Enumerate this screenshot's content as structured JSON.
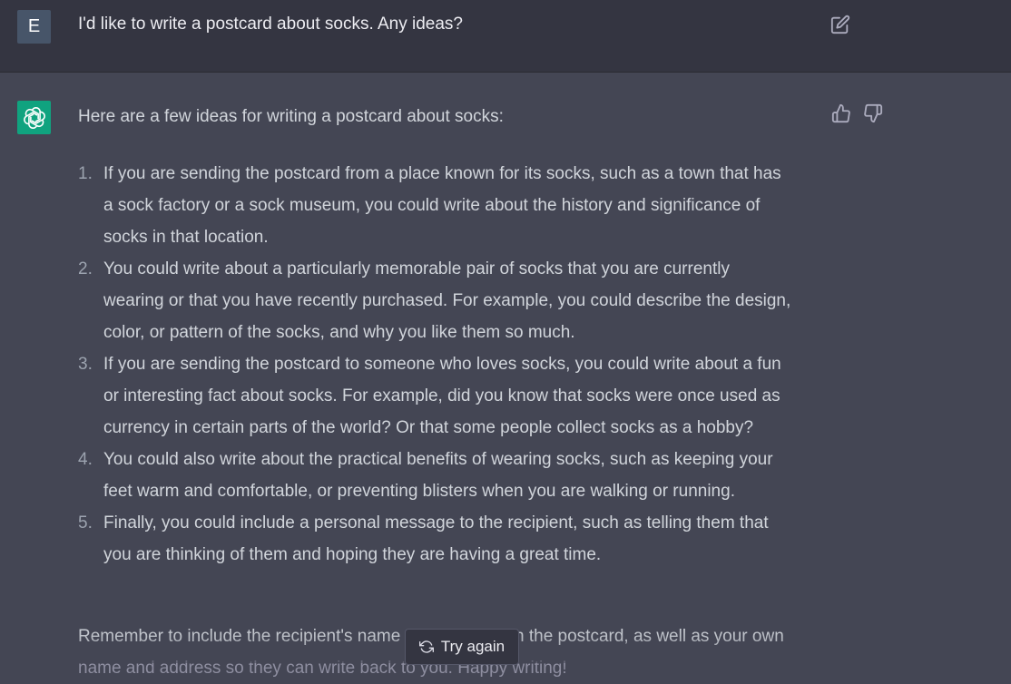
{
  "user_message": {
    "avatar_letter": "E",
    "text": "I'd like to write a postcard about socks. Any ideas?",
    "edit_icon": "edit-icon"
  },
  "assistant_message": {
    "avatar_icon": "openai-logo-icon",
    "intro": "Here are a few ideas for writing a postcard about socks:",
    "ideas": [
      {
        "number": "1.",
        "lines": [
          "If you are sending the postcard from a place known for its socks, such as a town that has",
          "a sock factory or a sock museum, you could write about the history and significance of",
          "socks in that location."
        ]
      },
      {
        "number": "2.",
        "lines": [
          "You could write about a particularly memorable pair of socks that you are currently",
          "wearing or that you have recently purchased. For example, you could describe the design,",
          "color, or pattern of the socks, and why you like them so much."
        ]
      },
      {
        "number": "3.",
        "lines": [
          "If you are sending the postcard to someone who loves socks, you could write about a fun",
          "or interesting fact about socks. For example, did you know that socks were once used as",
          "currency in certain parts of the world? Or that some people collect socks as a hobby?"
        ]
      },
      {
        "number": "4.",
        "lines": [
          "You could also write about the practical benefits of wearing socks, such as keeping your",
          "feet warm and comfortable, or preventing blisters when you are walking or running."
        ]
      },
      {
        "number": "5.",
        "lines": [
          "Finally, you could include a personal message to the recipient, such as telling them that",
          "you are thinking of them and hoping they are having a great time."
        ]
      }
    ],
    "outro_line1": "Remember to include the recipient's name and address on the postcard, as well as your own",
    "outro_line2": "name and address so they can write back to you. Happy writing!",
    "thumb_up_icon": "thumbs-up-icon",
    "thumb_down_icon": "thumbs-down-icon"
  },
  "try_again": {
    "label": "Try again",
    "icon": "refresh-icon"
  }
}
